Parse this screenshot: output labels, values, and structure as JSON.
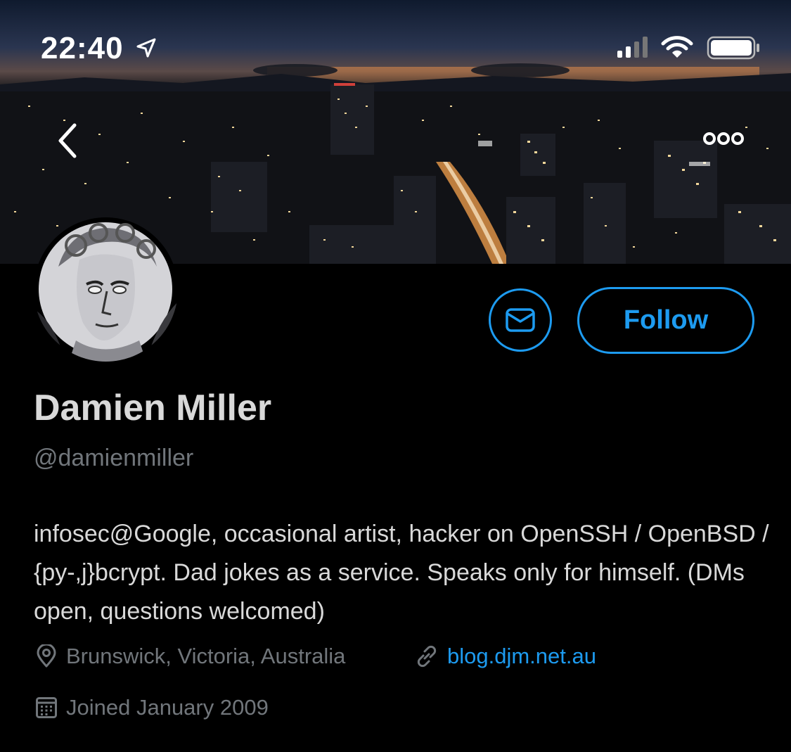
{
  "status_bar": {
    "time": "22:40"
  },
  "profile": {
    "display_name": "Damien Miller",
    "handle": "@damienmiller",
    "bio": "infosec@Google, occasional artist, hacker on OpenSSH / OpenBSD / {py-,j}bcrypt. Dad jokes as a service. Speaks only for himself. (DMs open, questions welcomed)",
    "location": "Brunswick, Victoria, Australia",
    "website": "blog.djm.net.au",
    "joined": "Joined January 2009"
  },
  "actions": {
    "follow_label": "Follow"
  },
  "colors": {
    "accent": "#1d9bf0",
    "background": "#000000",
    "secondary_text": "#71767b",
    "primary_text": "#d9d9d9"
  },
  "icons": [
    "location-arrow-icon",
    "signal-icon",
    "wifi-icon",
    "battery-icon",
    "back-chevron-icon",
    "more-icon",
    "envelope-icon",
    "location-pin-icon",
    "link-icon",
    "calendar-icon"
  ]
}
